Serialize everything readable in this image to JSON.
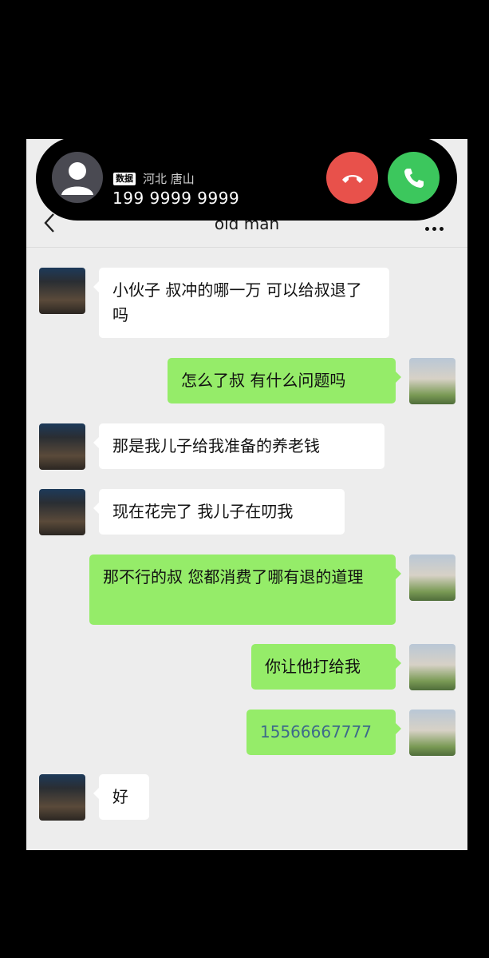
{
  "call": {
    "network_tag": "数据",
    "location": "河北 唐山",
    "number": "199 9999 9999",
    "decline_icon": "phone-hangup-icon",
    "accept_icon": "phone-answer-icon"
  },
  "header": {
    "title": "old man",
    "back_icon": "chevron-left-icon",
    "more_icon": "more-dots-icon"
  },
  "messages": [
    {
      "from": "contact",
      "text": "小伙子 叔冲的哪一万 可以给叔退了吗"
    },
    {
      "from": "me",
      "text": "怎么了叔 有什么问题吗"
    },
    {
      "from": "contact",
      "text": "那是我儿子给我准备的养老钱"
    },
    {
      "from": "contact",
      "text": "现在花完了 我儿子在叨我"
    },
    {
      "from": "me",
      "text": "那不行的叔 您都消费了哪有退的道理"
    },
    {
      "from": "me",
      "text": "你让他打给我"
    },
    {
      "from": "me",
      "text": "15566667777"
    },
    {
      "from": "contact",
      "text": "好"
    }
  ],
  "colors": {
    "outgoing_bubble": "#95ec69",
    "incoming_bubble": "#ffffff",
    "decline": "#e8514b",
    "accept": "#3cc75d",
    "chat_bg": "#ededed"
  }
}
